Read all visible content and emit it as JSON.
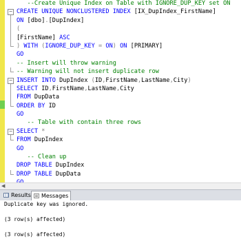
{
  "editor": {
    "lines": [
      [
        {
          "t": "   --Create Unique Index on Table with IGNORE_DUP_KEY set ON",
          "c": "cm"
        }
      ],
      [
        {
          "t": "CREATE UNIQUE NONCLUSTERED INDEX",
          "c": "kw"
        },
        {
          "t": " [IX_DupIndex_FirstName]",
          "c": "tx"
        }
      ],
      [
        {
          "t": "ON",
          "c": "kw"
        },
        {
          "t": " [dbo]",
          "c": "tx"
        },
        {
          "t": ".",
          "c": "gr"
        },
        {
          "t": "[DupIndex]",
          "c": "tx"
        }
      ],
      [
        {
          "t": "(",
          "c": "gr"
        }
      ],
      [
        {
          "t": "[FirstName]",
          "c": "tx"
        },
        {
          "t": " ASC",
          "c": "kw"
        }
      ],
      [
        {
          "t": ") ",
          "c": "gr"
        },
        {
          "t": "WITH",
          "c": "kw"
        },
        {
          "t": " (",
          "c": "gr"
        },
        {
          "t": "IGNORE_DUP_KEY",
          "c": "kw"
        },
        {
          "t": " = ",
          "c": "gr"
        },
        {
          "t": "ON",
          "c": "kw"
        },
        {
          "t": ") ",
          "c": "gr"
        },
        {
          "t": "ON",
          "c": "kw"
        },
        {
          "t": " [PRIMARY]",
          "c": "tx"
        }
      ],
      [
        {
          "t": "GO",
          "c": "kw"
        }
      ],
      [
        {
          "t": "-- Insert will throw warning",
          "c": "cm"
        }
      ],
      [
        {
          "t": "-- Warning will not insert duplicate row",
          "c": "cm"
        }
      ],
      [
        {
          "t": "INSERT INTO",
          "c": "kw"
        },
        {
          "t": " DupIndex ",
          "c": "tx"
        },
        {
          "t": "(",
          "c": "gr"
        },
        {
          "t": "ID",
          "c": "tx"
        },
        {
          "t": ",",
          "c": "gr"
        },
        {
          "t": "FirstName",
          "c": "tx"
        },
        {
          "t": ",",
          "c": "gr"
        },
        {
          "t": "LastName",
          "c": "tx"
        },
        {
          "t": ",",
          "c": "gr"
        },
        {
          "t": "City",
          "c": "tx"
        },
        {
          "t": ")",
          "c": "gr"
        }
      ],
      [
        {
          "t": "SELECT",
          "c": "kw"
        },
        {
          "t": " ID",
          "c": "tx"
        },
        {
          "t": ",",
          "c": "gr"
        },
        {
          "t": "FirstName",
          "c": "tx"
        },
        {
          "t": ",",
          "c": "gr"
        },
        {
          "t": "LastName",
          "c": "tx"
        },
        {
          "t": ",",
          "c": "gr"
        },
        {
          "t": "City",
          "c": "tx"
        }
      ],
      [
        {
          "t": "FROM",
          "c": "kw"
        },
        {
          "t": " DupData",
          "c": "tx"
        }
      ],
      [
        {
          "t": "ORDER BY",
          "c": "kw"
        },
        {
          "t": " ID",
          "c": "tx"
        }
      ],
      [
        {
          "t": "GO",
          "c": "kw"
        }
      ],
      [
        {
          "t": "   -- Table with contain three rows",
          "c": "cm"
        }
      ],
      [
        {
          "t": "SELECT",
          "c": "kw"
        },
        {
          "t": " *",
          "c": "gr"
        }
      ],
      [
        {
          "t": "FROM",
          "c": "kw"
        },
        {
          "t": " DupIndex",
          "c": "tx"
        }
      ],
      [
        {
          "t": "GO",
          "c": "kw"
        }
      ],
      [
        {
          "t": "   -- Clean up",
          "c": "cm"
        }
      ],
      [
        {
          "t": "DROP TABLE",
          "c": "kw"
        },
        {
          "t": " DupIndex",
          "c": "tx"
        }
      ],
      [
        {
          "t": "DROP TABLE",
          "c": "kw"
        },
        {
          "t": " DupData",
          "c": "tx"
        }
      ],
      [
        {
          "t": "GO",
          "c": "kw"
        }
      ]
    ],
    "folds": [
      "",
      "open",
      "line",
      "line",
      "line",
      "end",
      "",
      "",
      "end",
      "open",
      "line",
      "line",
      "end",
      "",
      "",
      "open",
      "end",
      "",
      "",
      "",
      "end",
      ""
    ]
  },
  "tabs": {
    "results_label": "Results",
    "messages_label": "Messages",
    "results_icon": "grid-icon",
    "messages_icon": "message-icon",
    "active": "Messages"
  },
  "messages": [
    "Duplicate key was ignored.",
    "",
    "(3 row(s) affected)",
    "",
    "(3 row(s) affected)"
  ],
  "colors": {
    "keyword": "#0000ff",
    "comment": "#008000",
    "operator": "#808080",
    "change_marker_saved": "#6fcf4f",
    "change_marker_unsaved": "#f0e74b"
  }
}
